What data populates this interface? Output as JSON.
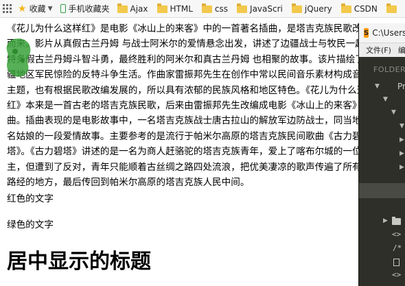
{
  "bookmarks": {
    "items": [
      {
        "icon": "star-icon",
        "label": "收藏",
        "has_caret": true
      },
      {
        "icon": "phone-icon",
        "label": "手机收藏夹"
      },
      {
        "icon": "folder-icon",
        "label": "Ajax"
      },
      {
        "icon": "folder-icon",
        "label": "HTML"
      },
      {
        "icon": "folder-icon",
        "label": "css"
      },
      {
        "icon": "folder-icon",
        "label": "JavaScri"
      },
      {
        "icon": "folder-icon",
        "label": "jQuery"
      },
      {
        "icon": "folder-icon",
        "label": "CSDN"
      },
      {
        "icon": "folder-icon",
        "label": ""
      }
    ]
  },
  "page": {
    "paragraph": "《花儿为什么这样红》是电影《冰山上的来客》中的一首著名插曲，是塔吉克族民歌改编而来。影片从真假古兰丹姆 与战士阿米尔的爱情悬念出发，讲述了边疆战士与牧民一起与特务假古兰丹姆斗智斗勇，最终胜利的阿米尔和真古兰丹姆 也相聚的故事。该片描绘了 边疆地区军民惊险的反特斗争生活。作曲家雷振邦先生在创作中常以民间音乐素材构成音乐主题，也有根据民歌改编发展的，所以具有浓郁的民族风格和地区特色。《花儿为什么这样红》本来是一首古老的塔吉克族民歌，后来由雷振邦先生改编成电影《冰山上的来客》插曲。插曲表现的是电影故事中，一名塔吉克族战士唐古拉山的解放军边防战士，同当地一名姑娘的一段爱情故事。主要参考的是流行于帕米尔高原的塔吉克族民间歌曲《古力碧塔》。《古力碧塔》讲述的是一名为商人赶骆驼的塔吉克族青年，爱上了喀布尔城的一位公主，但遭到了反对，青年只能顺着古丝绸之路四处流浪，把优美凄凉的歌声传遍了所有他路经的地方，最后传回到帕米尔高原的塔吉克族人民中间。",
    "red_text": "红色的文字",
    "green_text": "绿色的文字",
    "center_title": "居中显示的标题"
  },
  "editor": {
    "title": "C:\\Users",
    "menu_file": "文件(F)",
    "menu_edit": "编辑",
    "folders_label": "FOLDERS",
    "tree_item_label": "Pr",
    "accent_color": "#ff9800"
  }
}
